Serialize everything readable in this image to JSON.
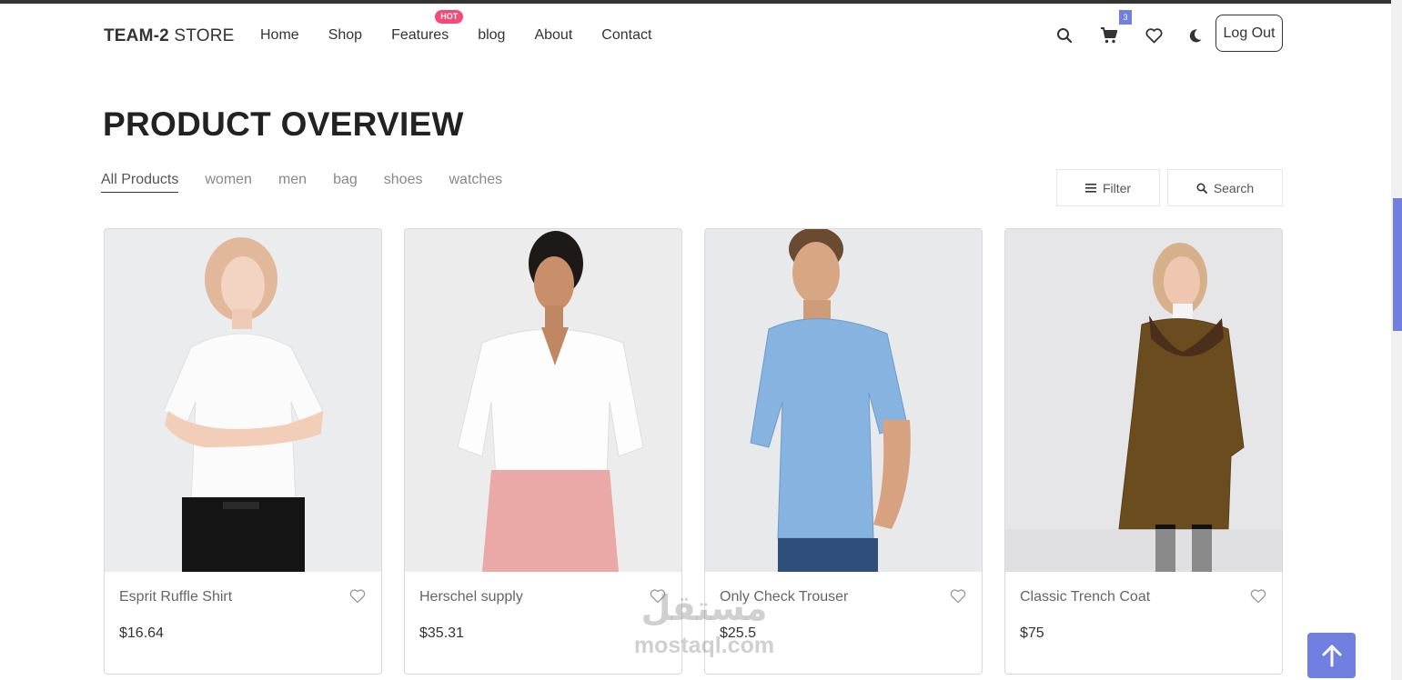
{
  "header": {
    "logo_bold": "TEAM-2",
    "logo_rest": " STORE",
    "nav": [
      "Home",
      "Shop",
      "Features",
      "blog",
      "About",
      "Contact"
    ],
    "hot_badge": "HOT",
    "cart_count": "3",
    "logout_label": "Log Out"
  },
  "overview": {
    "title": "PRODUCT OVERVIEW",
    "tabs": [
      "All Products",
      "women",
      "men",
      "bag",
      "shoes",
      "watches"
    ],
    "active_tab": "All Products",
    "filter_label": "Filter",
    "search_label": "Search"
  },
  "products": [
    {
      "name": "Esprit Ruffle Shirt",
      "price": "$16.64",
      "image": "woman-white-tshirt"
    },
    {
      "name": "Herschel supply",
      "price": "$35.31",
      "image": "woman-white-shirt-pink-pants"
    },
    {
      "name": "Only Check Trouser",
      "price": "$25.5",
      "image": "man-blue-check-shirt"
    },
    {
      "name": "Classic Trench Coat",
      "price": "$75",
      "image": "woman-brown-coat"
    }
  ],
  "watermark": {
    "arabic": "مستقل",
    "latin": "mostaql.com"
  },
  "colors": {
    "accent": "#717fe0",
    "hot": "#f74877",
    "text": "#333333"
  },
  "icons": [
    "search-icon",
    "cart-icon",
    "heart-icon",
    "moon-icon",
    "menu-lines-icon",
    "arrow-up-icon"
  ]
}
